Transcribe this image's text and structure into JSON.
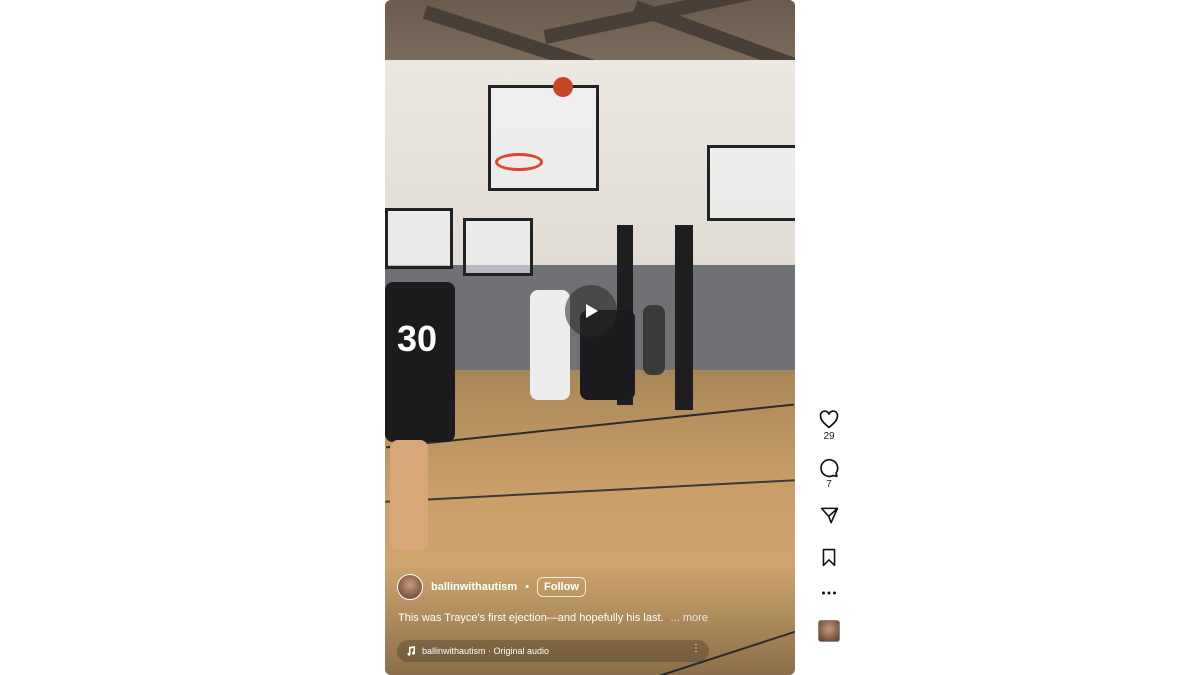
{
  "post": {
    "username": "ballinwithautism",
    "separator": "•",
    "follow_label": "Follow",
    "caption": "This was Trayce's first ejection—and hopefully his last.",
    "more_label": "... more",
    "audio_label": "ballinwithautism · Original audio"
  },
  "video": {
    "jersey_number": "30",
    "state": "paused"
  },
  "actions": {
    "like_count": "29",
    "comment_count": "7"
  },
  "icons": {
    "like": "heart-icon",
    "comment": "comment-bubble-icon",
    "share": "paper-plane-icon",
    "save": "bookmark-icon",
    "more": "more-options-icon",
    "play": "play-icon",
    "audio": "music-note-icon"
  }
}
